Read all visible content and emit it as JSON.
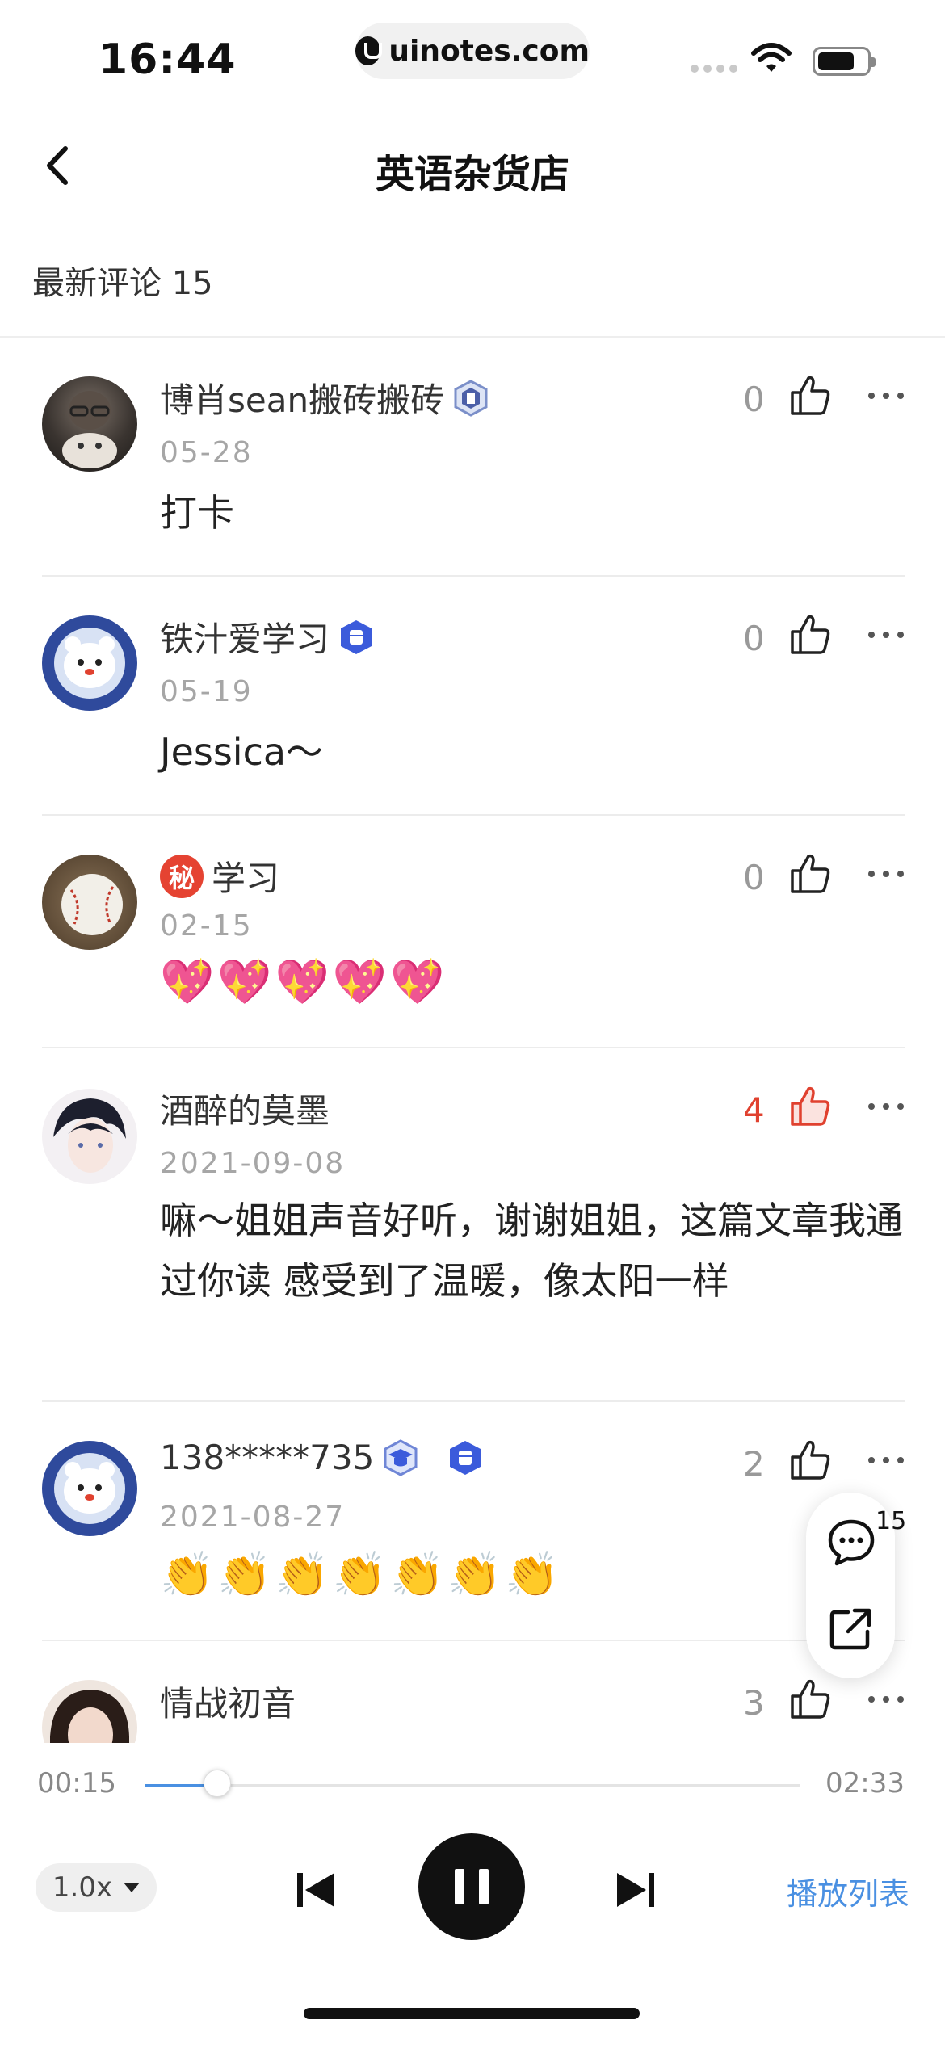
{
  "status_bar": {
    "time": "16:44",
    "url": "uinotes.com"
  },
  "nav": {
    "title": "英语杂货店"
  },
  "comments_header": {
    "label": "最新评论 15"
  },
  "comments": [
    {
      "name": "博肖sean搬砖搬砖",
      "date": "05-28",
      "text": "打卡",
      "likes": "0",
      "liked": false,
      "badges": [
        "rank-badge"
      ]
    },
    {
      "name": "铁汁爱学习",
      "date": "05-19",
      "text": "Jessica～",
      "likes": "0",
      "liked": false,
      "badges": [
        "fist-badge"
      ]
    },
    {
      "name": "学习",
      "secret_badge": "秘",
      "date": "02-15",
      "text": "💖💖💖💖💖",
      "likes": "0",
      "liked": false,
      "badges": []
    },
    {
      "name": "酒醉的莫墨",
      "date": "2021-09-08",
      "text": "嘛～姐姐声音好听，谢谢姐姐，这篇文章我通过你读 感受到了温暖，像太阳一样",
      "likes": "4",
      "liked": true,
      "badges": []
    },
    {
      "name": "138*****735",
      "date": "2021-08-27",
      "text": "👏👏👏👏👏👏👏",
      "likes": "2",
      "liked": false,
      "badges": [
        "graduate-badge",
        "fist-badge"
      ]
    },
    {
      "name": "情战初音",
      "date": "",
      "text": "",
      "likes": "3",
      "liked": false,
      "badges": []
    }
  ],
  "float_actions": {
    "comment_count": "15"
  },
  "player": {
    "current_time": "00:15",
    "total_time": "02:33",
    "progress": 0.11,
    "speed": "1.0x",
    "playlist_label": "播放列表",
    "state": "playing"
  },
  "colors": {
    "accent": "#4a90e2",
    "liked": "#e0412f",
    "badge_blue": "#3b5bdb"
  }
}
